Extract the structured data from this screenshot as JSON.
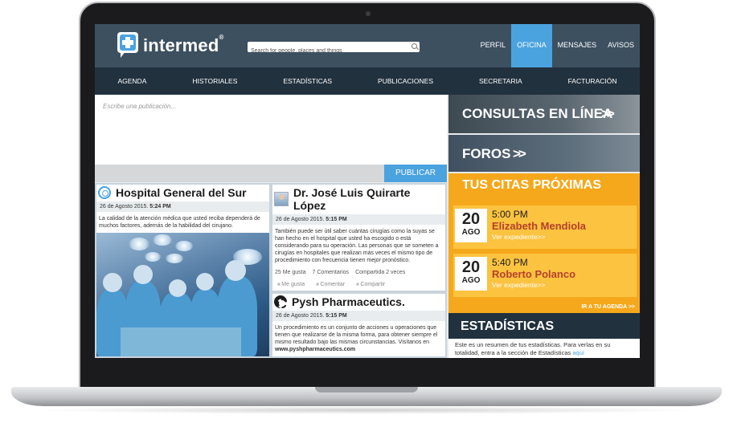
{
  "header": {
    "brand": "intermed",
    "brand_mark": "®",
    "search_placeholder": "Search for people, places and things",
    "nav": [
      "PERFIL",
      "OFICINA",
      "MENSAJES",
      "AVISOS"
    ],
    "active_nav": "OFICINA"
  },
  "subnav": [
    "AGENDA",
    "HISTORIALES",
    "ESTADÍSTICAS",
    "PUBLICACIONES",
    "SECRETARIA",
    "FACTURACIÓN"
  ],
  "composer": {
    "placeholder": "Escribe una publicación...",
    "button": "PUBLICAR"
  },
  "posts": [
    {
      "icon": "target-icon",
      "title": "Hospital General del Sur",
      "date": "26 de Agosto 2015.",
      "time": "5:24 PM",
      "text": "La calidad de la atención médica que usted reciba dependerá de muchos factores, además de la habilidad del cirujano."
    },
    {
      "icon": "doctor-avatar",
      "title": "Dr. José Luis Quirarte López",
      "date": "26 de Agosto 2015.",
      "time": "5:15 PM",
      "text": "También puede ser útil saber cuántas cirugías como la suyas se han hecho en el hospital que usted ha escogido o está considerando para su operación. Las personas que se someten a cirugías en hospitales que realizan más veces el mismo tipo de procedimiento con frecuencia tienen mejor pronóstico.",
      "stats": [
        "25 Me gusta",
        "7 Comentarios",
        "Compartida 2 veces"
      ],
      "actions": [
        "Me gusta",
        "Comentar",
        "Compartir"
      ]
    },
    {
      "icon": "aperture-icon",
      "title": "Pysh Pharmaceutics.",
      "date": "26 de Agosto 2015.",
      "time": "5:15 PM",
      "text": "Un procedimiento es un conjunto de acciones u operaciones que tienen que realizarse de la misma forma, para obtener siempre el mismo resultado bajo las mismas circunstancias. Visítanos en",
      "link": "www.pyshpharmaceutics.com"
    }
  ],
  "sidebar": {
    "consultas": "CONSULTAS EN LÍNEA",
    "foros": "FOROS",
    "arrows": ">>",
    "citas_title": "TUS CITAS PRÓXIMAS",
    "citas": [
      {
        "day": "20",
        "month": "AGO",
        "time": "5:00 PM",
        "name": "Elizabeth Mendiola",
        "link": "Ver expediente>>"
      },
      {
        "day": "20",
        "month": "AGO",
        "time": "5:40 PM",
        "name": "Roberto Polanco",
        "link": "Ver expediente>>"
      }
    ],
    "ir_agenda": "IR A TU AGENDA >>",
    "estadisticas_title": "ESTADÍSTICAS",
    "estadisticas_text": "Este es un resumen de tus estadísticas. Para verlas en su totalidad, entra a la sección de Estadísticas",
    "estadisticas_link": "aquí"
  },
  "colors": {
    "topbar": "#3d5060",
    "accent_blue": "#4aa3df",
    "subnav": "#22313e",
    "citas_orange": "#f5a81b",
    "name_red": "#b5402a"
  }
}
